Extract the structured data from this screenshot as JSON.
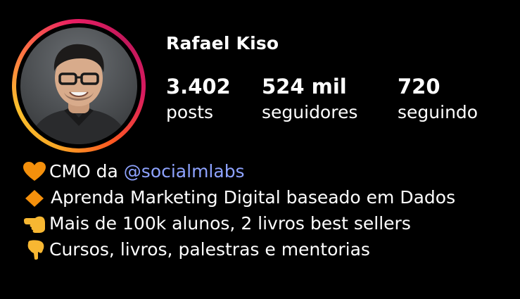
{
  "profile": {
    "username": "Rafael Kiso",
    "stats": {
      "posts": {
        "value": "3.402",
        "label": "posts"
      },
      "followers": {
        "value": "524 mil",
        "label": "seguidores"
      },
      "following": {
        "value": "720",
        "label": "seguindo"
      }
    },
    "bio": {
      "line1_prefix": "CMO da ",
      "line1_mention": "@socialmlabs",
      "line2": "Aprenda Marketing Digital baseado em Dados",
      "line3": "Mais de 100k alunos, 2 livros best sellers",
      "line4": "Cursos, livros, palestras e mentorias"
    },
    "icons": {
      "line1": "orange-heart-icon",
      "line2": "orange-diamond-icon",
      "line3": "pointing-left-hand-icon",
      "line4": "pointing-down-hand-icon"
    }
  },
  "colors": {
    "background": "#000000",
    "text": "#ffffff",
    "mention": "#8ea3ff",
    "ring_start": "#f9a825",
    "ring_end": "#e91e63"
  }
}
